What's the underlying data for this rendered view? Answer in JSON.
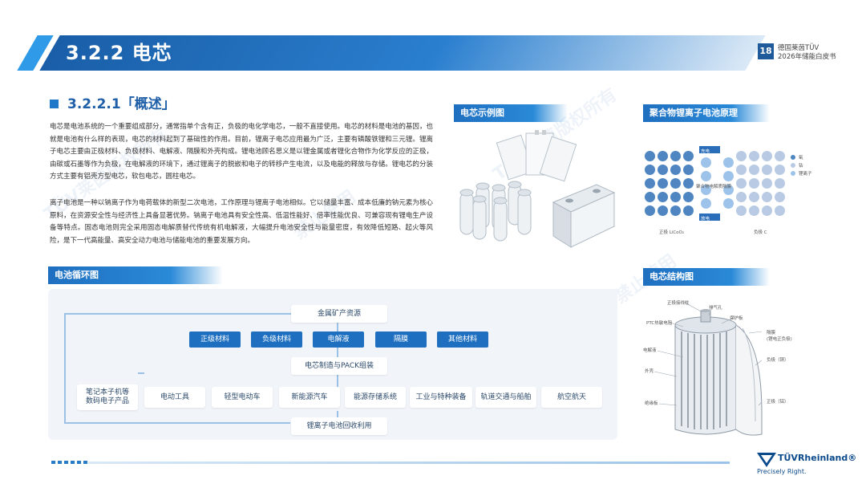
{
  "header": {
    "section_title": "3.2.2 电芯",
    "page_number": "18",
    "brand_line1": "德国莱茵TÜV",
    "brand_line2": "2026年储能白皮书"
  },
  "section": {
    "heading": "3.2.2.1「概述」",
    "paragraph1": "电芯是电池系统的一个重要组成部分，通常指单个含有正，负极的电化学电芯，一般不直接使用。电芯的材料是电池的基因，也就是电池有什么样的表现，电芯的材料起到了基础性的作用。目前，锂离子电芯应用最为广泛，主要有磷酸铁锂和三元锂。锂离子电芯主要由正极材料、负极材料、电解液、隔膜和外壳构成。锂电池顾名思义是以锂金属或者锂化合物作为化学反应的正极，由碳或石墨等作为负极，在电解液的环境下，通过锂离子的脱嵌和电子的转移产生电流，以及电能的释放与存储。锂电芯的分装方式主要有铝壳方型电芯，软包电芯，圆柱电芯。",
    "paragraph2": "离子电池是一种以钠离子作为电荷载体的新型二次电池，工作原理与锂离子电池相似。它以储量丰富、成本低廉的钠元素为核心原料，在资源安全性与经济性上具备显著优势。钠离子电池具有安全性高、低温性能好、倍率性能优良、可兼容现有锂电生产设备等特点。固态电池则完全采用固态电解质替代传统有机电解液，大幅提升电池安全性与能量密度，有效降低短路、起火等风险，是下一代高能量、高安全动力电池与储能电池的重要发展方向。"
  },
  "tags": {
    "cell_example": "电芯示例图",
    "polymer_principle": "聚合物锂离子电池原理",
    "battery_cycle": "电池循环图",
    "cell_structure": "电芯结构图"
  },
  "principle": {
    "legend_oxygen": "氧",
    "legend_cobalt": "钴",
    "legend_li_ion": "锂离子",
    "cathode_label": "正极 LiCoO₂",
    "anode_label": "负极 C",
    "separator_label": "聚合物电解质隔膜",
    "charge_label": "充电",
    "discharge_label": "放电"
  },
  "cycle": {
    "top": "金属矿产资源",
    "materials": [
      "正级材料",
      "负级材料",
      "电解液",
      "隔膜",
      "其他材料"
    ],
    "middle": "电芯制造与PACK组装",
    "applications": [
      "笔记本子机等\n数码电子产品",
      "电动工具",
      "轻型电动车",
      "新能源汽车",
      "能源存储系统",
      "工业与特种装备",
      "轨道交通与船舶",
      "航空航天"
    ],
    "bottom": "锂离子电池回收利用"
  },
  "structure": {
    "labels": [
      "正极接线柱",
      "排气孔",
      "PTC热敏电阻",
      "保护板",
      "隔膜\n(锂电正负极)",
      "电解液",
      "负极（铜）",
      "外壳",
      "正极（铝）",
      "绝缘板"
    ]
  },
  "footer": {
    "logo": "TÜVRheinland®",
    "slogan": "Precisely Right."
  },
  "colors": {
    "primary": "#1f6fc0",
    "dark": "#1f5a9a",
    "accent": "#2a8ad8"
  }
}
